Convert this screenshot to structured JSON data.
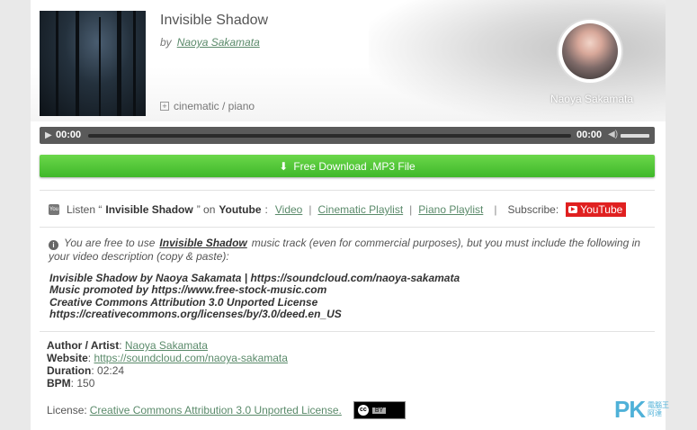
{
  "track": {
    "title": "Invisible Shadow",
    "by_prefix": "by",
    "artist": "Naoya Sakamata",
    "tags": "cinematic / piano",
    "avatar_name": "Naoya Sakamata"
  },
  "player": {
    "current_time": "00:00",
    "duration_time": "00:00"
  },
  "download": {
    "label": "Free Download .MP3 File"
  },
  "youtube": {
    "listen_prefix": "Listen “",
    "listen_title": "Invisible Shadow",
    "listen_mid": "” on ",
    "listen_platform": "Youtube",
    "listen_colon": ":",
    "links": [
      "Video",
      "Cinematic Playlist",
      "Piano Playlist"
    ],
    "subscribe_label": "Subscribe:",
    "badge_label": "YouTube"
  },
  "notice": {
    "pre": "You are free to use",
    "track_link": "Invisible Shadow",
    "post": "music track (even for commercial purposes), but you must include the following in your video description (copy & paste):"
  },
  "credits": [
    "Invisible Shadow by Naoya Sakamata | https://soundcloud.com/naoya-sakamata",
    "Music promoted by https://www.free-stock-music.com",
    "Creative Commons Attribution 3.0 Unported License",
    "https://creativecommons.org/licenses/by/3.0/deed.en_US"
  ],
  "meta": {
    "author_label": "Author / Artist",
    "author_value": "Naoya Sakamata",
    "website_label": "Website",
    "website_value": "https://soundcloud.com/naoya-sakamata",
    "duration_label": "Duration",
    "duration_value": "02:24",
    "bpm_label": "BPM",
    "bpm_value": "150"
  },
  "license": {
    "label": "License:",
    "link": "Creative Commons Attribution 3.0 Unported License.",
    "badge_cc": "cc",
    "badge_by": "BY"
  },
  "watermark": {
    "logo": "PK",
    "sub1": "電腦王",
    "sub2": "阿達"
  },
  "colors": {
    "link": "#5a8a6a",
    "download_green": "#3fb82a",
    "youtube_red": "#e02020",
    "player_bg": "#5a5a5a"
  }
}
